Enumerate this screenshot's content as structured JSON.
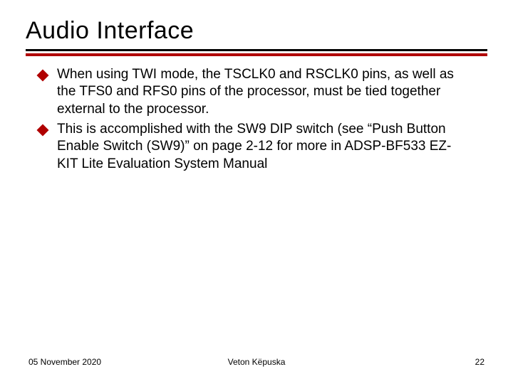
{
  "title": "Audio Interface",
  "bullets": [
    "When using TWI mode, the TSCLK0 and RSCLK0 pins, as well as the TFS0 and RFS0 pins of the processor, must be tied together external to the processor.",
    "This is accomplished with the SW9 DIP switch (see “Push Button Enable Switch (SW9)” on page 2-12 for more in ADSP-BF533 EZ-KIT Lite Evaluation System Manual"
  ],
  "footer": {
    "date": "05 November 2020",
    "author": "Veton Këpuska",
    "page": "22"
  }
}
